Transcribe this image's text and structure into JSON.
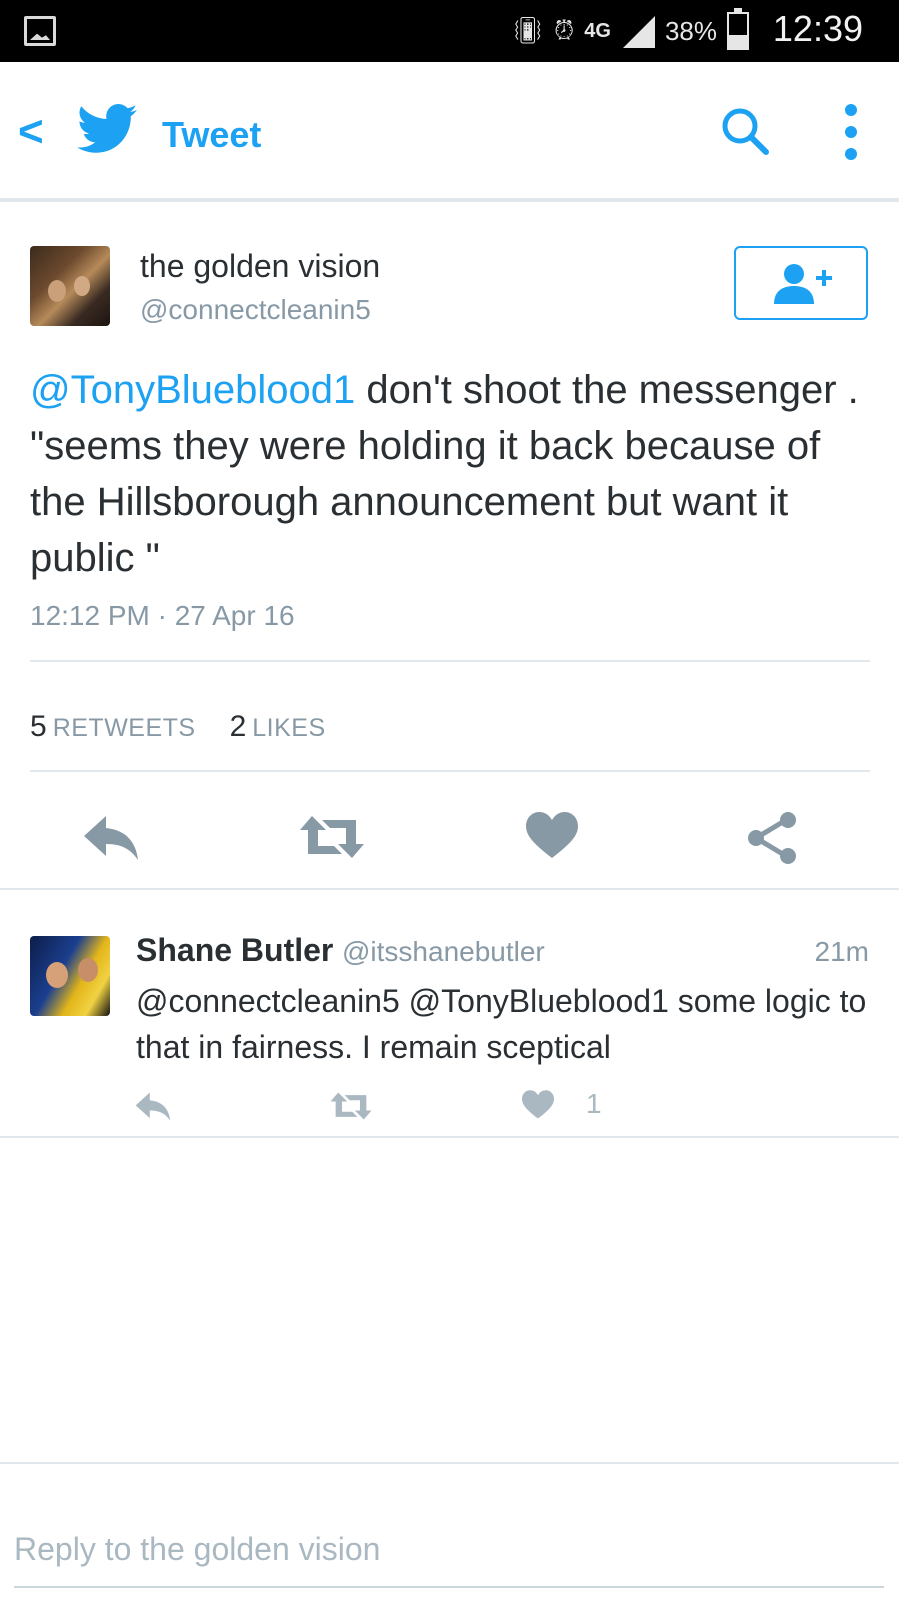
{
  "status_bar": {
    "network": "4G",
    "battery_percent": "38%",
    "time": "12:39"
  },
  "header": {
    "title": "Tweet",
    "accent_color": "#1da1f2"
  },
  "tweet": {
    "author_name": "the golden vision",
    "author_handle": "@connectcleanin5",
    "mention": "@TonyBlueblood1",
    "text": " don't shoot the messenger . \"seems they were holding it back because of the Hillsborough announcement but want it public \"",
    "timestamp": "12:12 PM · 27 Apr 16",
    "retweet_count": "5",
    "retweet_label": "RETWEETS",
    "like_count": "2",
    "like_label": "LIKES"
  },
  "reply": {
    "author_name": "Shane Butler",
    "author_handle": "@itsshanebutler",
    "time": "21m",
    "text": "@connectcleanin5 @TonyBlueblood1 some logic to that in fairness. I remain sceptical",
    "like_count": "1"
  },
  "composer": {
    "placeholder": "Reply to the golden vision"
  },
  "icons": [
    "gallery-icon",
    "vibrate-icon",
    "alarm-icon",
    "signal-icon",
    "battery-icon",
    "back-icon",
    "twitter-bird-icon",
    "search-icon",
    "overflow-menu-icon",
    "follow-user-icon",
    "reply-icon",
    "retweet-icon",
    "like-icon",
    "share-icon"
  ]
}
